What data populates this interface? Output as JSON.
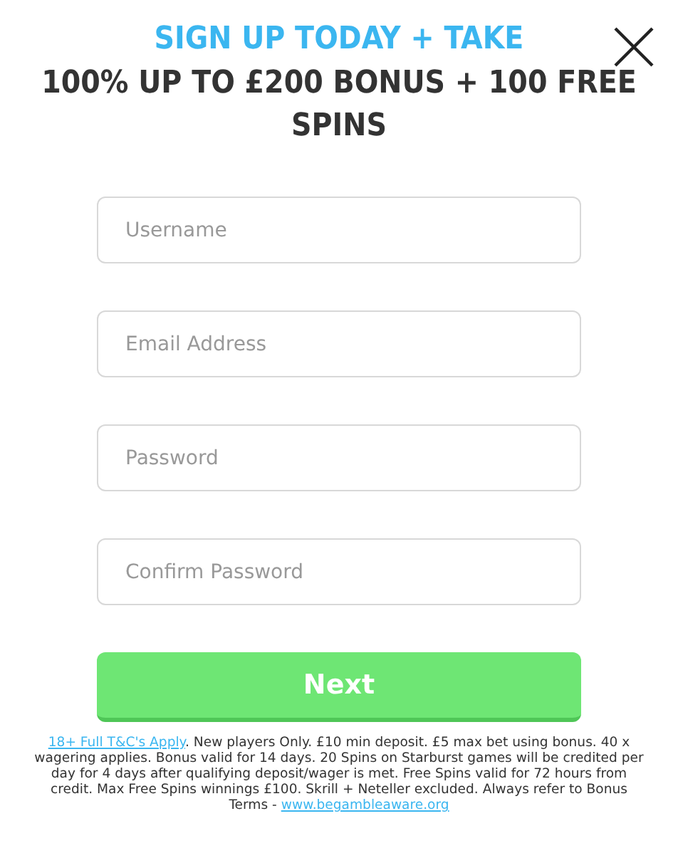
{
  "heading": {
    "lead": "SIGN UP TODAY + TAKE",
    "offer": "100% UP TO £200 BONUS + 100 FREE SPINS"
  },
  "fields": [
    {
      "placeholder": "Username"
    },
    {
      "placeholder": "Email Address"
    },
    {
      "placeholder": "Password"
    },
    {
      "placeholder": "Confirm Password"
    }
  ],
  "submit_button": "Next",
  "terms": {
    "link": "18+ Full T&C's Apply",
    "text": ". New players Only. £10 min deposit. £5 max bet using bonus. 40 x wagering applies. Bonus valid for 14 days. 20 Spins on Starburst games will be credited per day for 4 days after qualifying deposit/wager is met. Free Spins valid for 72 hours from credit. Max Free Spins winnings £100. Skrill + Neteller excluded. Always refer to Bonus Terms - ",
    "site_link": "www.begambleaware.org"
  }
}
